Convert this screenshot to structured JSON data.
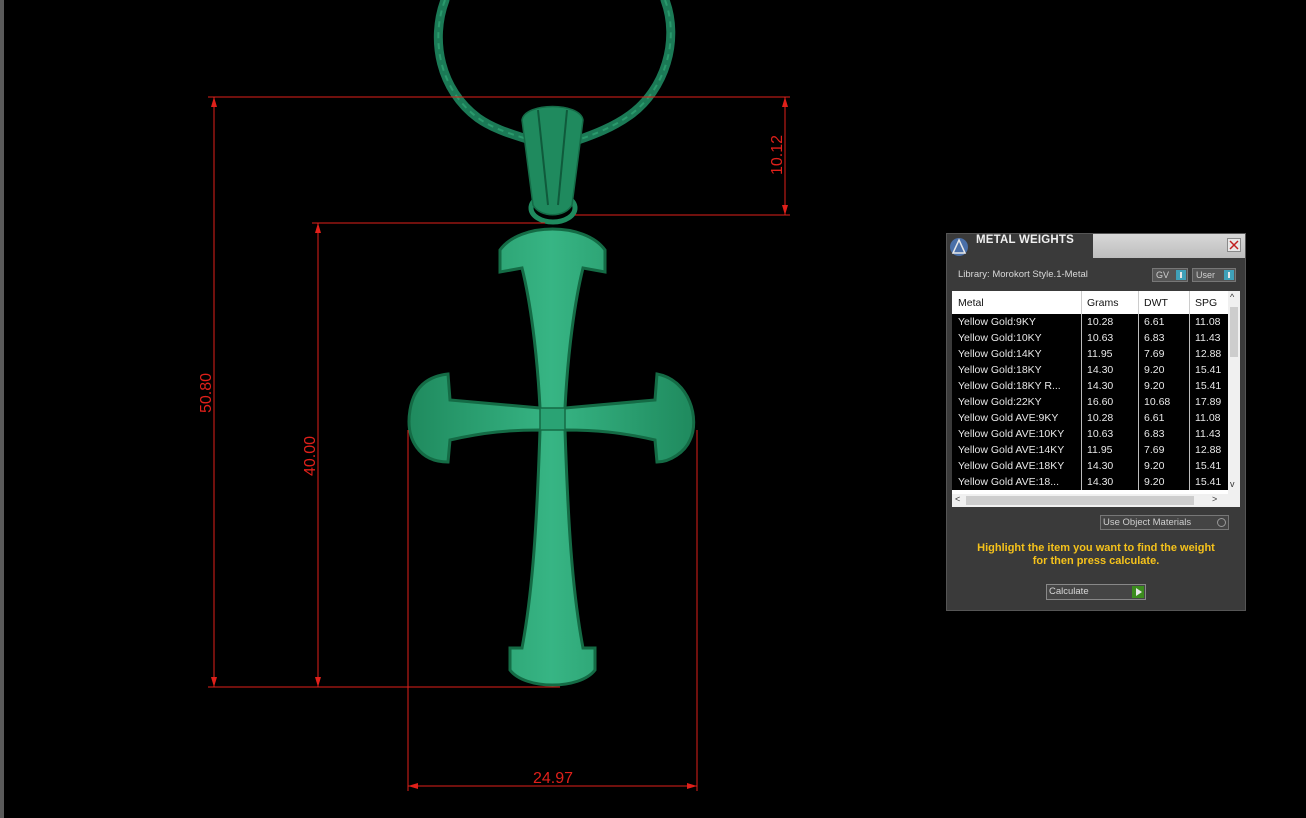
{
  "dimensions": {
    "overall_height": "50.80",
    "cross_height": "40.00",
    "bail_height": "10.12",
    "width": "24.97"
  },
  "panel": {
    "title": "METAL WEIGHTS",
    "library_label": "Library: Morokort Style.1-Metal",
    "toggle_gv": "GV",
    "toggle_user": "User",
    "columns": [
      "Metal",
      "Grams",
      "DWT",
      "SPG"
    ],
    "rows": [
      [
        "Yellow Gold:9KY",
        "10.28",
        "6.61",
        "11.08"
      ],
      [
        "Yellow Gold:10KY",
        "10.63",
        "6.83",
        "11.43"
      ],
      [
        "Yellow Gold:14KY",
        "11.95",
        "7.69",
        "12.88"
      ],
      [
        "Yellow Gold:18KY",
        "14.30",
        "9.20",
        "15.41"
      ],
      [
        "Yellow Gold:18KY R...",
        "14.30",
        "9.20",
        "15.41"
      ],
      [
        "Yellow Gold:22KY",
        "16.60",
        "10.68",
        "17.89"
      ],
      [
        "Yellow Gold AVE:9KY",
        "10.28",
        "6.61",
        "11.08"
      ],
      [
        "Yellow Gold AVE:10KY",
        "10.63",
        "6.83",
        "11.43"
      ],
      [
        "Yellow Gold AVE:14KY",
        "11.95",
        "7.69",
        "12.88"
      ],
      [
        "Yellow Gold AVE:18KY",
        "14.30",
        "9.20",
        "15.41"
      ],
      [
        "Yellow Gold AVE:18...",
        "14.30",
        "9.20",
        "15.41"
      ]
    ],
    "use_object_materials": "Use Object Materials",
    "hint_line1": "Highlight the item you want to find the weight",
    "hint_line2": "for then press calculate.",
    "calculate_label": "Calculate",
    "colors": {
      "hint": "#f5c21b",
      "model": "#2eae7c",
      "dimension": "#e0201a"
    }
  }
}
